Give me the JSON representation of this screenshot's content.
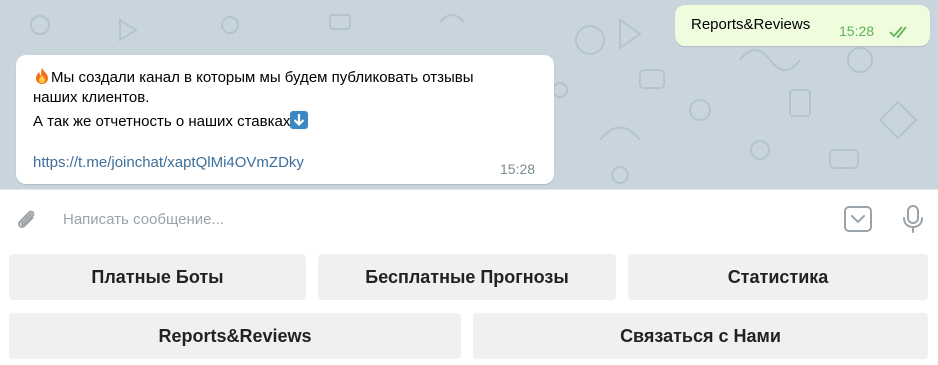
{
  "colors": {
    "chat_bg": "#c8d5dc",
    "outgoing_bubble": "#effdde",
    "incoming_bubble": "#ffffff",
    "link": "#3c6f9c",
    "read_ticks": "#5fb15a",
    "keyboard_button": "#f0f0f0"
  },
  "messages": {
    "outgoing": {
      "text": "Reports&Reviews",
      "time": "15:28",
      "status_icon": "double-check-icon"
    },
    "incoming": {
      "emoji_fire": "fire-emoji",
      "line1": "Мы создали канал в которым мы будем публиковать отзывы",
      "line2": "наших клиентов.",
      "line3": "А так же отчетность о наших ставках",
      "emoji_arrow": "down-arrow-emoji",
      "link": "https://t.me/joinchat/xaptQlMi4OVmZDky",
      "time": "15:28"
    }
  },
  "composer": {
    "placeholder": "Написать сообщение...",
    "value": "",
    "attach_icon": "paperclip-icon",
    "keyboard_icon": "keyboard-toggle-icon",
    "mic_icon": "microphone-icon"
  },
  "keyboard": {
    "row1": [
      "Платные Боты",
      "Бесплатные Прогнозы",
      "Статистика"
    ],
    "row2": [
      "Reports&Reviews",
      "Связаться с Нами"
    ]
  }
}
